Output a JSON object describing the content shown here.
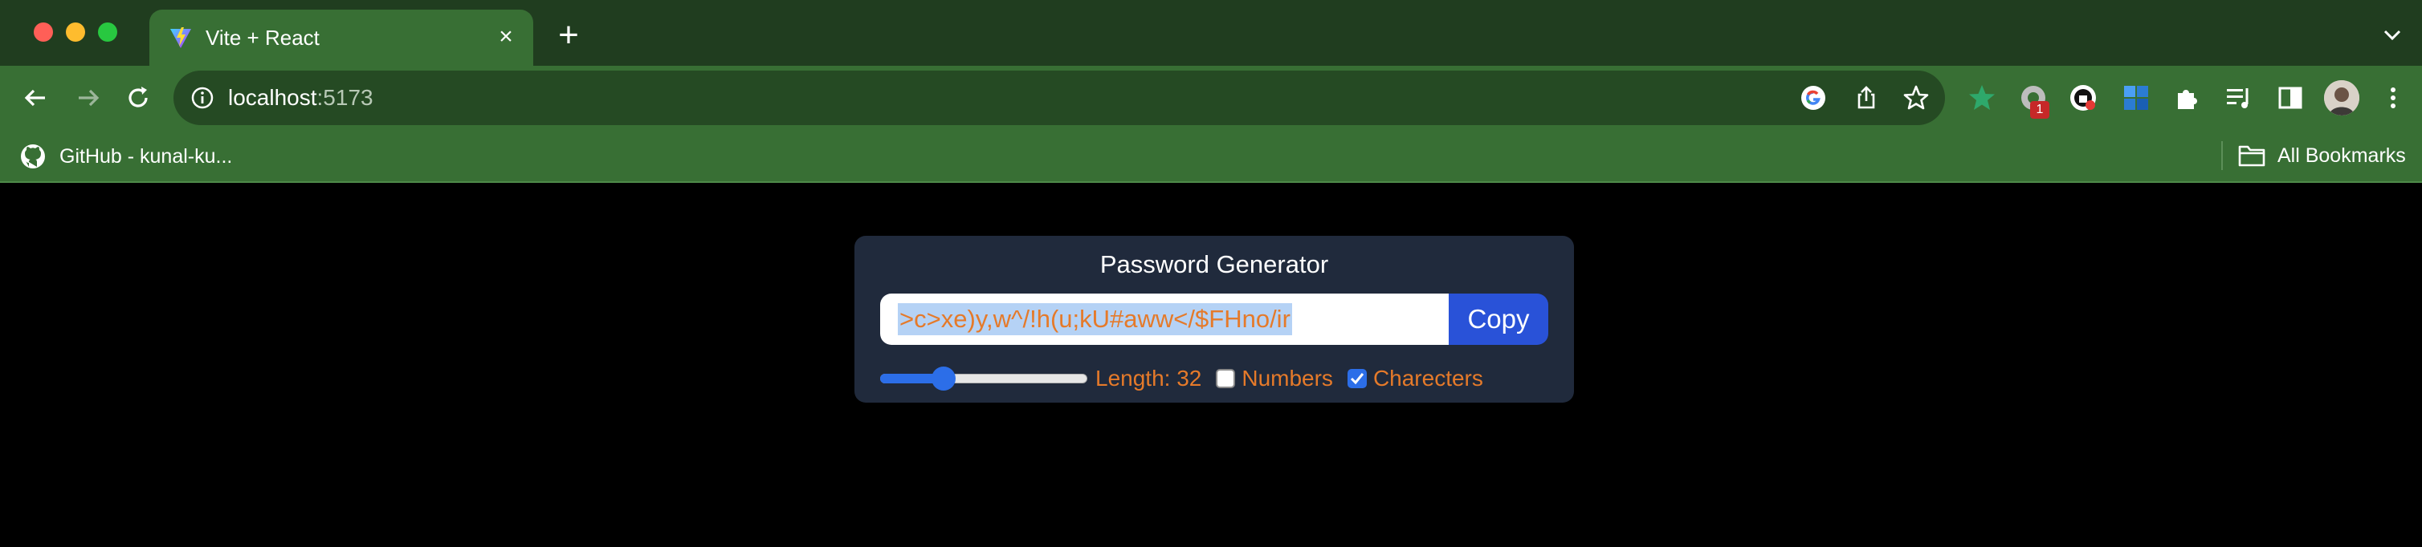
{
  "browser": {
    "tab": {
      "title": "Vite + React",
      "close_glyph": "×"
    },
    "new_tab_glyph": "+",
    "address": {
      "host": "localhost",
      "port": ":5173"
    },
    "bookmarks": [
      {
        "label": "GitHub - kunal-ku...",
        "icon": "github-icon"
      }
    ],
    "all_bookmarks_label": "All Bookmarks",
    "extension_badge": "1",
    "colors": {
      "tabbar": "#203d1f",
      "toolbar": "#386f34",
      "omnibox": "#254a23"
    }
  },
  "app": {
    "title": "Password Generator",
    "password": ">c>xe)y,w^/!h(u;kU#aww</$FHno/ir",
    "copy_label": "Copy",
    "length_label": "Length: 32",
    "length_slider_fraction": 0.28,
    "numbers_label": "Numbers",
    "numbers_checked": false,
    "characters_label": "Charecters",
    "characters_checked": true,
    "colors": {
      "card": "#202a3c",
      "accent_text": "#e57a2a",
      "button": "#2952d8"
    }
  }
}
